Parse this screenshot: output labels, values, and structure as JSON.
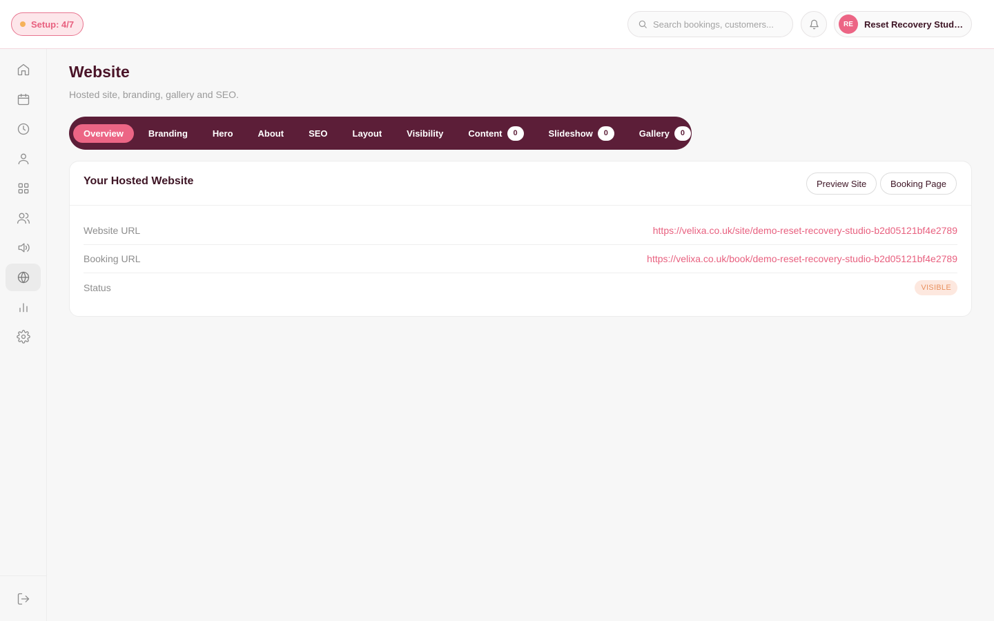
{
  "topbar": {
    "setup_label": "Setup: 4/7",
    "search_placeholder": "Search bookings, customers...",
    "account_initials": "RE",
    "account_name": "Reset Recovery Studio..."
  },
  "sidebar": {
    "items": [
      {
        "icon": "home-icon"
      },
      {
        "icon": "calendar-icon"
      },
      {
        "icon": "clock-icon"
      },
      {
        "icon": "user-icon"
      },
      {
        "icon": "grid-icon"
      },
      {
        "icon": "users-icon"
      },
      {
        "icon": "megaphone-icon"
      },
      {
        "icon": "globe-icon",
        "active": true
      },
      {
        "icon": "bar-chart-icon"
      },
      {
        "icon": "settings-icon"
      }
    ],
    "logout_icon": "logout-icon"
  },
  "page": {
    "title": "Website",
    "subtitle": "Hosted site, branding, gallery and SEO."
  },
  "tabs": [
    {
      "label": "Overview",
      "active": true
    },
    {
      "label": "Branding"
    },
    {
      "label": "Hero"
    },
    {
      "label": "About"
    },
    {
      "label": "SEO"
    },
    {
      "label": "Layout"
    },
    {
      "label": "Visibility"
    },
    {
      "label": "Content",
      "count": "0"
    },
    {
      "label": "Slideshow",
      "count": "0"
    },
    {
      "label": "Gallery",
      "count": "0"
    }
  ],
  "card": {
    "title": "Your Hosted Website",
    "preview_button": "Preview Site",
    "booking_button": "Booking Page",
    "rows": [
      {
        "label": "Website URL",
        "value": "https://velixa.co.uk/site/demo-reset-recovery-studio-b2d05121bf4e2789"
      },
      {
        "label": "Booking URL",
        "value": "https://velixa.co.uk/book/demo-reset-recovery-studio-b2d05121bf4e2789"
      },
      {
        "label": "Status",
        "value": "VISIBLE"
      }
    ]
  },
  "colors": {
    "brand": "#5c1e38",
    "accent": "#ec6585",
    "link": "#e8607f",
    "badge_bg": "#fde8df",
    "badge_text": "#e9915f"
  }
}
